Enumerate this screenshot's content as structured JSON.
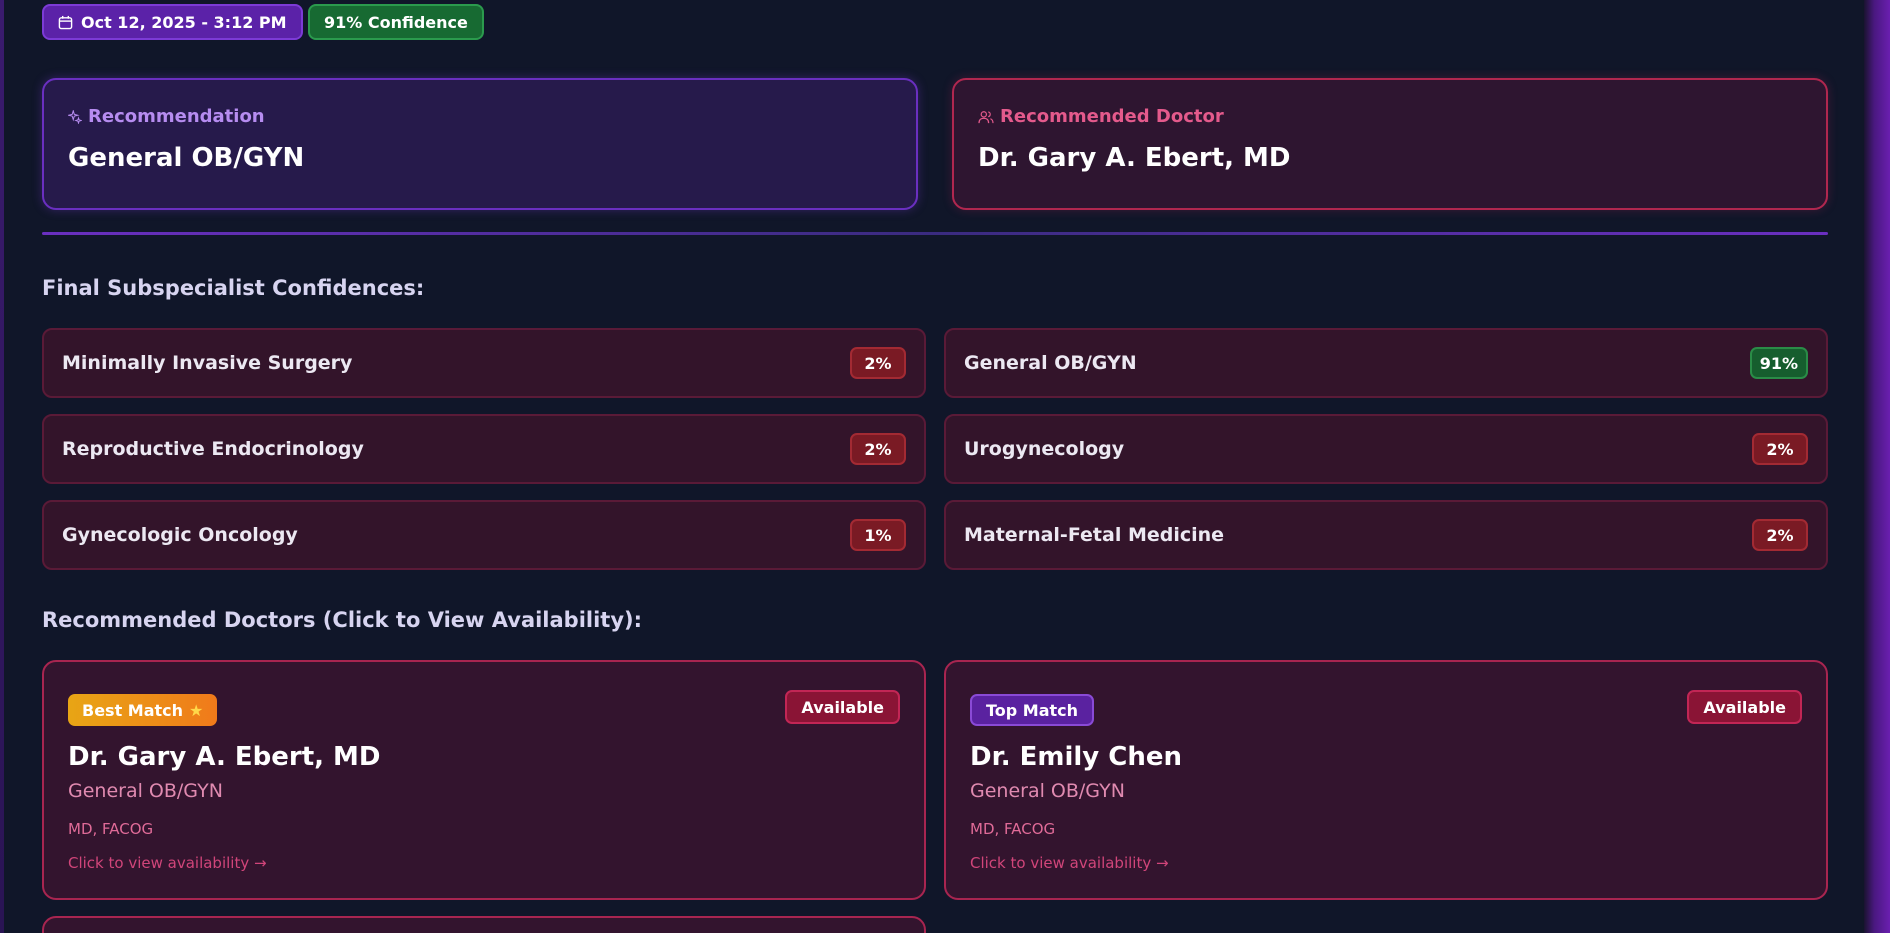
{
  "header": {
    "date_chip": "Oct 12, 2025 - 3:12 PM",
    "confidence_chip": "91% Confidence"
  },
  "recommendation": {
    "label": "Recommendation",
    "value": "General OB/GYN"
  },
  "recommended_doctor": {
    "label": "Recommended Doctor",
    "value": "Dr. Gary A. Ebert, MD"
  },
  "confidences": {
    "title": "Final Subspecialist Confidences:",
    "items": [
      {
        "name": "Minimally Invasive Surgery",
        "percent": "2%"
      },
      {
        "name": "General OB/GYN",
        "percent": "91%"
      },
      {
        "name": "Reproductive Endocrinology",
        "percent": "2%"
      },
      {
        "name": "Urogynecology",
        "percent": "2%"
      },
      {
        "name": "Gynecologic Oncology",
        "percent": "1%"
      },
      {
        "name": "Maternal-Fetal Medicine",
        "percent": "2%"
      }
    ]
  },
  "doctors": {
    "title": "Recommended Doctors (Click to View Availability):",
    "cards": [
      {
        "badge": "Best Match",
        "status": "Available",
        "name": "Dr. Gary A. Ebert, MD",
        "specialty": "General OB/GYN",
        "credentials": "MD, FACOG",
        "link": "Click to view availability →"
      },
      {
        "badge": "Top Match",
        "status": "Available",
        "name": "Dr. Emily Chen",
        "specialty": "General OB/GYN",
        "credentials": "MD, FACOG",
        "link": "Click to view availability →"
      }
    ]
  },
  "icons": {
    "date": "calendar-icon",
    "recommendation": "sparkle-icon",
    "doctor": "users-icon",
    "best_match": "star-icon"
  },
  "colors": {
    "background": "#101629",
    "purple_accent": "#6a2fc0",
    "pink_accent": "#b0274f",
    "success": "#2a8c47",
    "danger": "#a32a33"
  }
}
